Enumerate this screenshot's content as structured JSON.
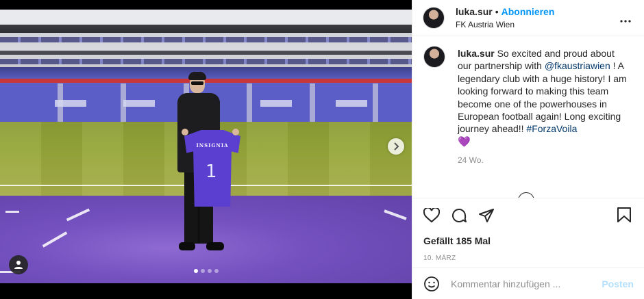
{
  "post": {
    "username": "luka.sur",
    "separator": "•",
    "follow_label": "Abonnieren",
    "location": "FK Austria Wien",
    "more_glyph": "• • •",
    "caption_user": "luka.sur",
    "caption_part1": "So excited and proud about our partnership with",
    "mention": "@fkaustriawien",
    "caption_part2": "! A legendary club with a huge history! I am looking forward to making this team become one of the powerhouses in European football again! Long exciting journey ahead!!",
    "hashtag": "#ForzaVoila",
    "heart_emoji": "💜",
    "caption_age": "24 Wo.",
    "likes": "Gefällt 185 Mal",
    "date": "10. März",
    "comment_placeholder": "Kommentar hinzufügen ...",
    "post_label": "Posten"
  },
  "photo": {
    "jersey_text": "INSIGNIA",
    "jersey_number": "1",
    "slides_count": 4,
    "active_slide": 1
  },
  "icons": {
    "next": "chevron-right-icon",
    "user_tag": "user-icon",
    "like": "heart-icon",
    "comment": "comment-icon",
    "share": "send-icon",
    "save": "bookmark-icon",
    "emoji": "smiley-icon",
    "more": "more-icon"
  }
}
